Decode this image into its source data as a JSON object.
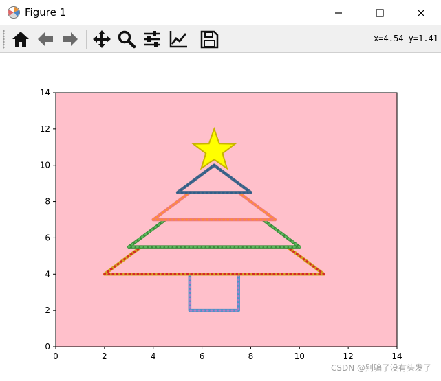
{
  "window": {
    "title": "Figure 1",
    "controls": [
      "minimize",
      "maximize",
      "close"
    ]
  },
  "toolbar": {
    "tools": [
      {
        "name": "home-icon",
        "tooltip": "Reset original view"
      },
      {
        "name": "back-icon",
        "tooltip": "Back to previous view"
      },
      {
        "name": "forward-icon",
        "tooltip": "Forward to next view"
      },
      {
        "name": "pan-icon",
        "tooltip": "Pan axes"
      },
      {
        "name": "zoom-icon",
        "tooltip": "Zoom to rectangle"
      },
      {
        "name": "subplots-icon",
        "tooltip": "Configure subplots"
      },
      {
        "name": "axes-edit-icon",
        "tooltip": "Edit axis, curve and image parameters"
      },
      {
        "name": "save-icon",
        "tooltip": "Save the figure"
      }
    ],
    "coords": "x=4.54 y=1.41"
  },
  "watermark": "CSDN @别骗了没有头发了",
  "chart_data": {
    "type": "line",
    "title": "",
    "xlabel": "",
    "ylabel": "",
    "xlim": [
      0,
      14
    ],
    "ylim": [
      0,
      14
    ],
    "xticks": [
      "0",
      "2",
      "4",
      "6",
      "8",
      "10",
      "12",
      "14"
    ],
    "yticks": [
      "0",
      "2",
      "4",
      "6",
      "8",
      "10",
      "12",
      "14"
    ],
    "grid": false,
    "legend": "none",
    "background": "#ffc0cb",
    "series": [
      {
        "x": [
          5.5,
          5.5,
          7.5,
          7.5
        ],
        "y": [
          4,
          2,
          2,
          4
        ],
        "color": "#4e94c8",
        "dots": "#b07ec8"
      },
      {
        "x": [
          2,
          11
        ],
        "y": [
          4,
          4
        ],
        "color": "#d4a520",
        "dots": "#d62728"
      },
      {
        "x": [
          2,
          3.5
        ],
        "y": [
          4,
          5.5
        ],
        "color": "#d4a520",
        "dots": "#d62728"
      },
      {
        "x": [
          11,
          9.5
        ],
        "y": [
          4,
          5.5
        ],
        "color": "#d4a520",
        "dots": "#d62728"
      },
      {
        "x": [
          3,
          10
        ],
        "y": [
          5.5,
          5.5
        ],
        "color": "#3a8a3a",
        "dots": "#5cb85c"
      },
      {
        "x": [
          3,
          4.5
        ],
        "y": [
          5.5,
          7
        ],
        "color": "#3a8a3a",
        "dots": "#5cb85c"
      },
      {
        "x": [
          10,
          8.5
        ],
        "y": [
          5.5,
          7
        ],
        "color": "#3a8a3a",
        "dots": "#5cb85c"
      },
      {
        "x": [
          4,
          9
        ],
        "y": [
          7,
          7
        ],
        "color": "#ef7b7b",
        "dots": "#ff8c3a"
      },
      {
        "x": [
          4,
          5.5
        ],
        "y": [
          7,
          8.5
        ],
        "color": "#ef7b7b",
        "dots": "#ff8c3a"
      },
      {
        "x": [
          9,
          7.5
        ],
        "y": [
          7,
          8.5
        ],
        "color": "#ef7b7b",
        "dots": "#ff8c3a"
      },
      {
        "x": [
          5,
          8
        ],
        "y": [
          8.5,
          8.5
        ],
        "color": "#4a6a8a",
        "dots": "#2f5d8a"
      },
      {
        "x": [
          5,
          6.5,
          8
        ],
        "y": [
          8.5,
          10,
          8.5
        ],
        "color": "#4a6a8a",
        "dots": "#2f5d8a"
      }
    ],
    "star": {
      "center": [
        6.5,
        10.8
      ],
      "outer_radius": 1.2,
      "inner_radius": 0.48,
      "fill": "#ffff00",
      "stroke": "#c8b400"
    }
  }
}
